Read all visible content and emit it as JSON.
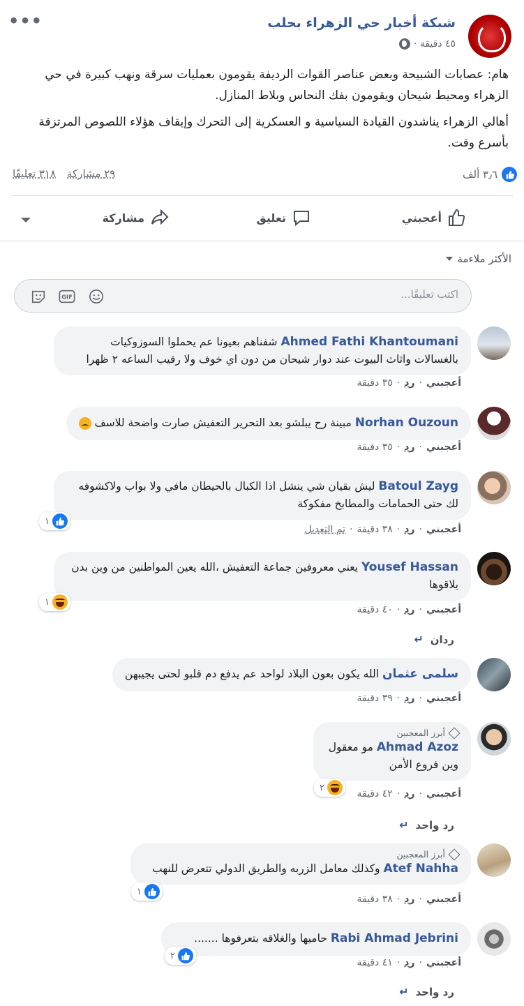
{
  "post": {
    "page_name": "شبكة أخبار حي الزهراء بحلب",
    "time": "٤٥ دقيقة ·",
    "paragraph1": "هام: عصابات الشبيحة وبعض عناصر القوات الرديفة يقومون بعمليات سرقة ونهب كبيرة في حي الزهراء ومحيط شيحان ويقومون بفك النحاس وبلاط المنازل.",
    "paragraph2": "أهالي الزهراء يناشدون القيادة السياسية و العسكرية إلى التحرك وإيقاف هؤلاء اللصوص المرتزقة بأسرع وقت.",
    "reactions_count": "٣٫٦ ألف",
    "comments_count": "٣١٨ تعليقًا",
    "shares_count": "٢٩ مشاركة"
  },
  "actions": {
    "like": "أعجبني",
    "comment": "تعليق",
    "share": "مشاركة"
  },
  "sort_label": "الأكثر ملاءمة",
  "comment_box": {
    "placeholder": "اكتب تعليقًا..."
  },
  "labels": {
    "like": "أعجبني",
    "reply": "رد",
    "edited": "تم التعديل",
    "top_fan": "أبرز المعجبين"
  },
  "comments": [
    {
      "author": "Ahmed Fathi Khantoumani",
      "text": "شفناهم بعيونا عم يحملوا السوزوكيات بالغسالات واثاث البيوت عند دوار شيحان من دون اي خوف ولا رقيب الساعه ٢ ظهرا",
      "time": "٣٥ دقيقة"
    },
    {
      "author": "Norhan Ouzoun",
      "text": "مبينة رح يبلشو بعد التحرير التعفيش صارت واضحة للاسف",
      "time": "٣٥ دقيقة"
    },
    {
      "author": "Batoul Zayg",
      "text": "ليش بقيان شي ينشل اذا الكبال بالحيطان مافي ولا بواب ولاكشوفه لك حتى الحمامات والمطابخ مفكوكة",
      "time": "٣٨ دقيقة",
      "reactions": "١"
    },
    {
      "author": "Yousef Hassan",
      "text": "يعني معروفين جماعة التعفيش ،الله يعين المواطنين من وين بدن يلاقوها",
      "time": "٤٠ دقيقة",
      "reactions": "١",
      "replies": "ردان"
    },
    {
      "author": "سلمى عثمان",
      "text": "الله يكون بعون البلاد لواحد عم يدفع دم قلبو لحتى يجيبهن",
      "time": "٣٩ دقيقة"
    },
    {
      "author": "Ahmad Azoz",
      "text": "مو معقول وين فروع الأمن",
      "time": "٤٢ دقيقة",
      "reactions": "٢",
      "replies": "رد واحد"
    },
    {
      "author": "Atef Nahha",
      "text": "وكذلك معامل الزربه والطريق الدولي تتعرض للنهب",
      "time": "٣٨ دقيقة",
      "reactions": "١"
    },
    {
      "author": "Rabi Ahmad Jebrini",
      "text": "حاميها والغلاقه بتعرفوها .......",
      "time": "٤١ دقيقة",
      "reactions": "٢",
      "replies": "رد واحد"
    }
  ],
  "colors": {
    "link": "#385898",
    "like_blue": "#1877f2",
    "bubble": "#f2f3f5",
    "muted": "#606770"
  }
}
